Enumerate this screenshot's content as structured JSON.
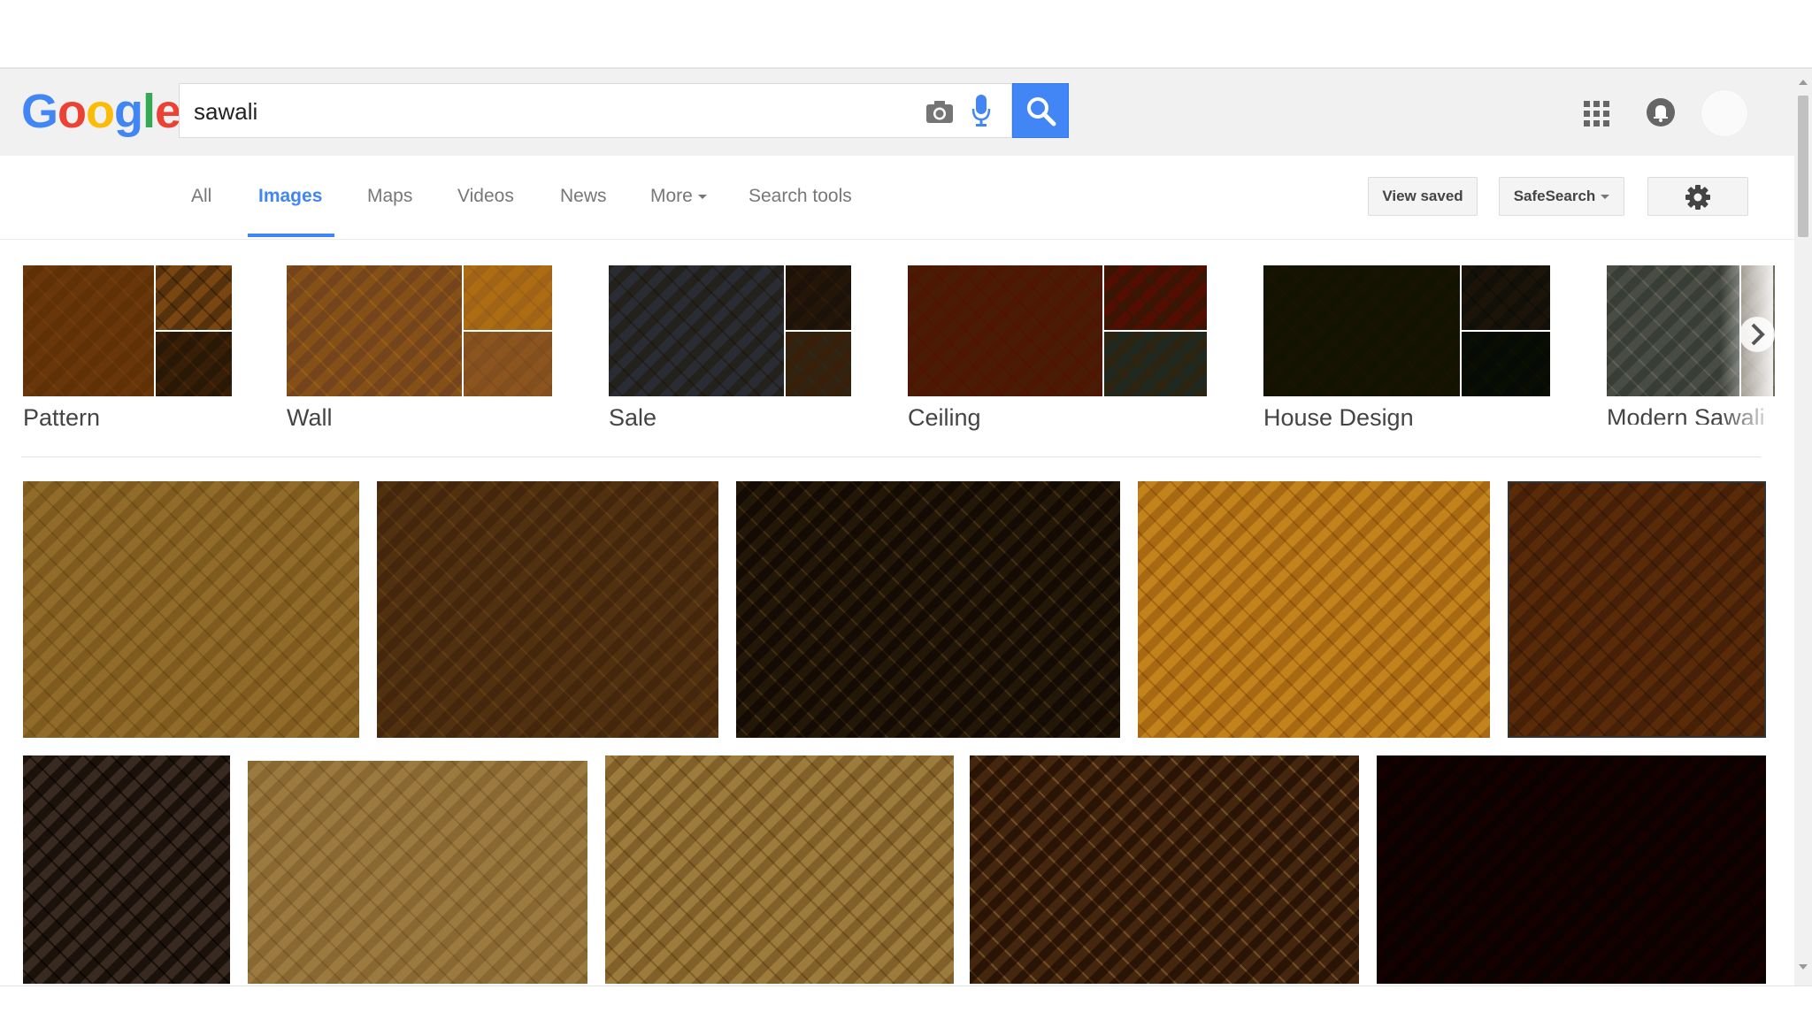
{
  "header": {
    "logo_letters": [
      "G",
      "o",
      "o",
      "g",
      "l",
      "e"
    ],
    "search_value": "sawali"
  },
  "tabs": {
    "all": "All",
    "images": "Images",
    "maps": "Maps",
    "videos": "Videos",
    "news": "News",
    "more": "More",
    "search_tools": "Search tools"
  },
  "toolbar": {
    "view_saved": "View saved",
    "safesearch": "SafeSearch"
  },
  "chips": [
    {
      "label": "Pattern",
      "colors": [
        "#b8924e",
        "#c7a66a",
        "#8c7448"
      ]
    },
    {
      "label": "Wall",
      "colors": [
        "#c4a57a",
        "#e0c06a",
        "#d1b07e"
      ]
    },
    {
      "label": "Sale",
      "colors": [
        "#8a8f95",
        "#7a6a55",
        "#9a7e54"
      ]
    },
    {
      "label": "Ceiling",
      "colors": [
        "#a97b45",
        "#b0612c",
        "#7f8a80"
      ]
    },
    {
      "label": "House Design",
      "colors": [
        "#6b6b32",
        "#7b6e55",
        "#4e5946"
      ]
    },
    {
      "label": "Modern Sawali",
      "colors": [
        "#9a9f98",
        "#c9c4bc",
        "#b9b3aa"
      ]
    }
  ],
  "results_row1": [
    {
      "color": "#d3bf8c",
      "accent": "#b9a26a"
    },
    {
      "color": "#a4885c",
      "accent": "#c4aa7a"
    },
    {
      "color": "#6b5a3e",
      "accent": "#c8b588"
    },
    {
      "color": "#e9cc7a",
      "accent": "#c9a452"
    },
    {
      "color": "#b48d55",
      "accent": "#8d6a3b"
    }
  ],
  "results_row2": [
    {
      "color": "#9a8c80",
      "accent": "#4a3a2a"
    },
    {
      "color": "#d8c7a0",
      "accent": "#bfab80"
    },
    {
      "color": "#d9c89e",
      "accent": "#b39d6a"
    },
    {
      "color": "#8a6c44",
      "accent": "#e6d8c0"
    },
    {
      "color": "#6c2a1f",
      "accent": "#3f4f33"
    }
  ],
  "colors": {
    "accent": "#4285f4",
    "header_bg": "#f1f1f1"
  }
}
